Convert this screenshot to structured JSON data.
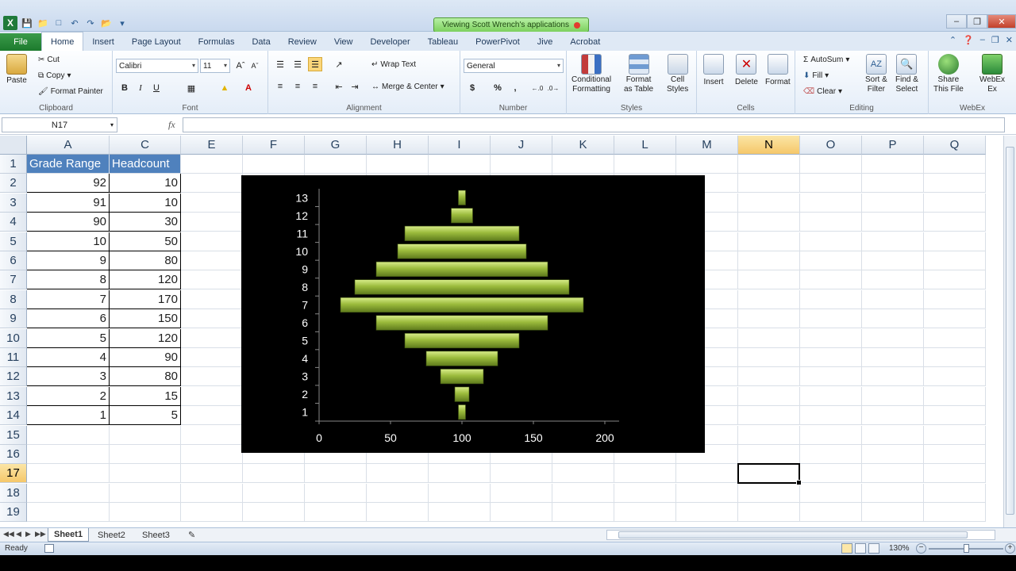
{
  "window": {
    "share_banner": "Viewing Scott Wrench's applications"
  },
  "ribbon_tabs": [
    "File",
    "Home",
    "Insert",
    "Page Layout",
    "Formulas",
    "Data",
    "Review",
    "View",
    "Developer",
    "Tableau",
    "PowerPivot",
    "Jive",
    "Acrobat"
  ],
  "ribbon": {
    "clipboard": {
      "paste": "Paste",
      "cut": "Cut",
      "copy": "Copy",
      "format_painter": "Format Painter",
      "label": "Clipboard"
    },
    "font": {
      "name": "Calibri",
      "size": "11",
      "bold": "B",
      "italic": "I",
      "underline": "U",
      "label": "Font"
    },
    "alignment": {
      "wrap_text": "Wrap Text",
      "merge_center": "Merge & Center",
      "label": "Alignment"
    },
    "number": {
      "format": "General",
      "currency": "$",
      "percent": "%",
      "comma": ",",
      "label": "Number"
    },
    "styles": {
      "conditional": "Conditional",
      "conditional2": "Formatting",
      "format_table": "Format",
      "format_table2": "as Table",
      "cell_styles": "Cell",
      "cell_styles2": "Styles",
      "label": "Styles"
    },
    "cells": {
      "insert": "Insert",
      "delete": "Delete",
      "format": "Format",
      "label": "Cells"
    },
    "editing": {
      "autosum": "AutoSum",
      "fill": "Fill",
      "clear": "Clear",
      "sort": "Sort &",
      "sort2": "Filter",
      "find": "Find &",
      "find2": "Select",
      "label": "Editing"
    },
    "webex": {
      "share": "Share",
      "share2": "This File",
      "webex": "WebEx",
      "webex2": "Ex",
      "label": "WebEx"
    }
  },
  "formula_bar": {
    "name_box": "N17",
    "fx": "fx",
    "value": ""
  },
  "columns": [
    "A",
    "C",
    "E",
    "F",
    "G",
    "H",
    "I",
    "J",
    "K",
    "L",
    "M",
    "N",
    "O",
    "P",
    "Q"
  ],
  "rows": [
    "1",
    "2",
    "3",
    "4",
    "5",
    "6",
    "7",
    "8",
    "9",
    "10",
    "11",
    "12",
    "13",
    "14",
    "15",
    "16",
    "17",
    "18",
    "19"
  ],
  "table": {
    "headers": [
      "Grade Range",
      "Headcount"
    ],
    "rows": [
      [
        "92",
        "10"
      ],
      [
        "91",
        "10"
      ],
      [
        "90",
        "30"
      ],
      [
        "10",
        "50"
      ],
      [
        "9",
        "80"
      ],
      [
        "8",
        "120"
      ],
      [
        "7",
        "170"
      ],
      [
        "6",
        "150"
      ],
      [
        "5",
        "120"
      ],
      [
        "4",
        "90"
      ],
      [
        "3",
        "80"
      ],
      [
        "2",
        "15"
      ],
      [
        "1",
        "5"
      ]
    ]
  },
  "chart_data": {
    "type": "bar",
    "orientation": "horizontal",
    "stacked_offset_style": "centered",
    "categories": [
      "1",
      "2",
      "3",
      "4",
      "5",
      "6",
      "7",
      "8",
      "9",
      "10",
      "11",
      "12",
      "13"
    ],
    "values": [
      5,
      10,
      30,
      50,
      80,
      120,
      170,
      150,
      120,
      90,
      80,
      15,
      5
    ],
    "bar_center": 100,
    "xlim": [
      0,
      200
    ],
    "xticks": [
      "0",
      "50",
      "100",
      "150",
      "200"
    ],
    "title": "",
    "xlabel": "",
    "ylabel": "",
    "background": "#000000",
    "bar_color": "#9bbb3c",
    "grid": false,
    "legend": "none"
  },
  "sheets": [
    "Sheet1",
    "Sheet2",
    "Sheet3"
  ],
  "status": {
    "ready": "Ready",
    "zoom": "130%",
    "zoom_minus": "−",
    "zoom_plus": "+"
  }
}
